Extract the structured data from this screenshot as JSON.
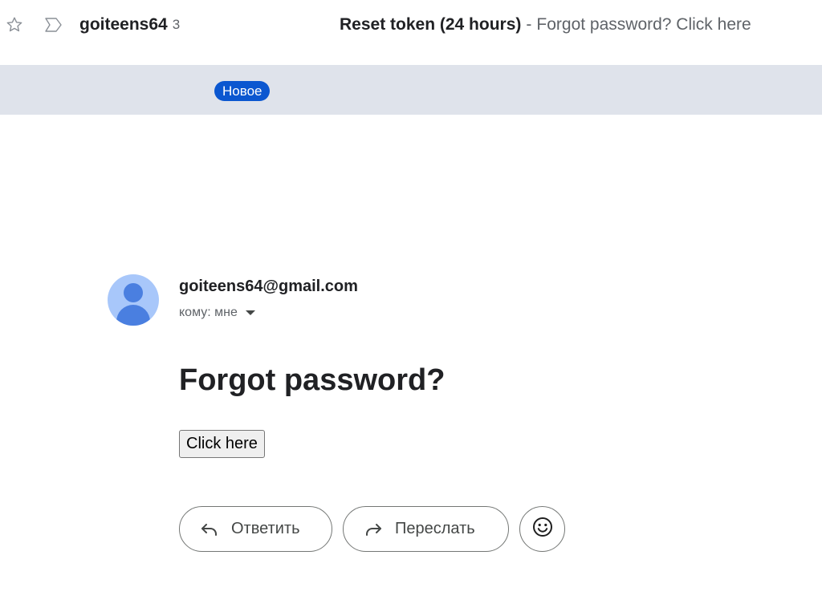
{
  "inbox_row": {
    "sender": "goiteens64",
    "count": "3",
    "badge": "Новое",
    "subject": "Reset token (24 hours)",
    "separator": "-",
    "snippet": "Forgot password? Click here",
    "star_icon": "star-outline-icon",
    "important_icon": "important-marker-icon"
  },
  "message": {
    "from": "goiteens64@gmail.com",
    "to": "кому: мне",
    "title": "Forgot password?",
    "button_label": "Click here"
  },
  "actions": {
    "reply_label": "Ответить",
    "forward_label": "Переслать",
    "reply_icon": "reply-arrow-icon",
    "forward_icon": "forward-arrow-icon",
    "emoji_icon": "smiley-icon"
  },
  "colors": {
    "row_background": "#dfe3eb",
    "badge_background": "#0b57d0",
    "avatar_background": "#a8c7fa"
  }
}
